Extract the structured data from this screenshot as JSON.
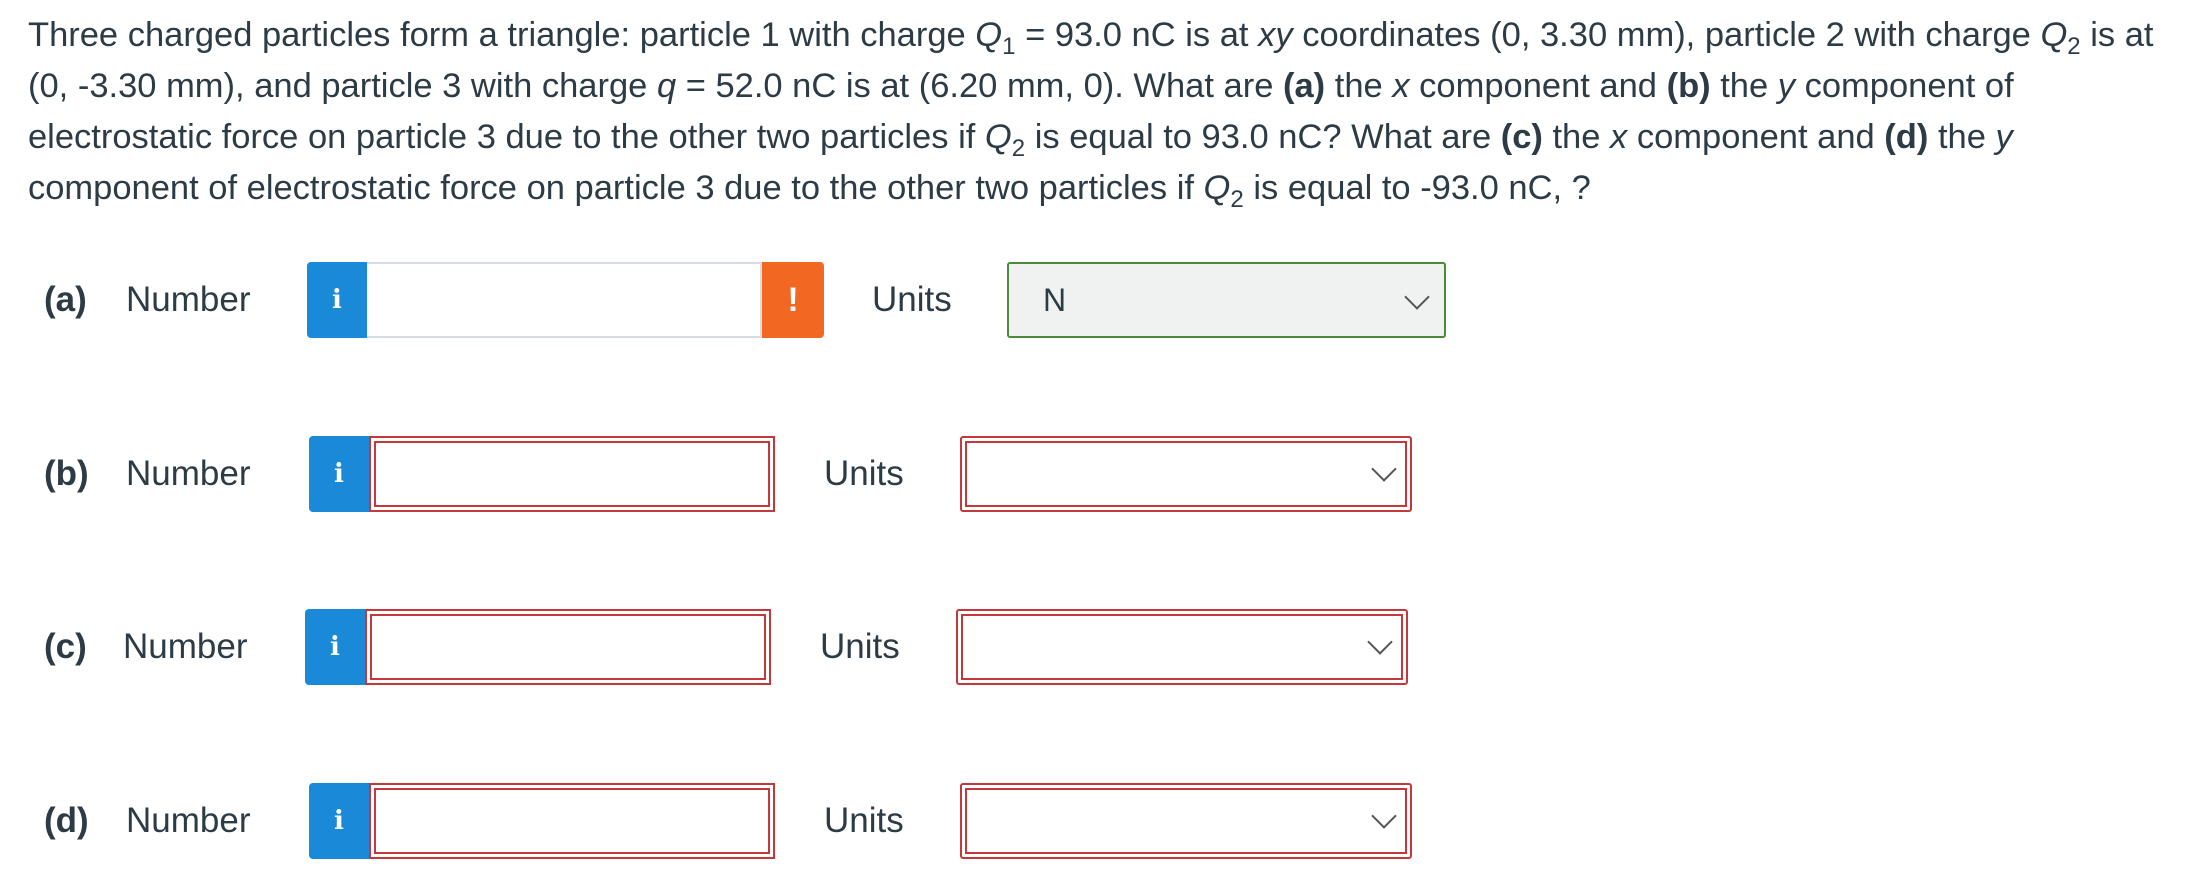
{
  "question": {
    "text_1": "Three charged particles form a triangle: particle 1 with charge ",
    "q1_symbol": "Q",
    "q1_sub": "1",
    "text_2": " = 93.0 nC is at ",
    "xy": "xy",
    "text_3": " coordinates (0, 3.30 mm), particle 2 with charge ",
    "q2_symbol": "Q",
    "q2_sub": "2",
    "text_4": " is at (0, -3.30 mm), and particle 3 with charge ",
    "q_symbol": "q",
    "text_5": " = 52.0 nC is at (6.20 mm, 0). What are ",
    "part_a": "(a)",
    "text_6": " the ",
    "x1": "x",
    "text_7": " component and ",
    "part_b": "(b)",
    "text_8": " the ",
    "y1": "y",
    "text_9": " component of electrostatic force on particle 3 due to the other two particles if ",
    "q2b_symbol": "Q",
    "q2b_sub": "2",
    "text_10": " is equal to 93.0 nC? What are ",
    "part_c": "(c)",
    "text_11": " the ",
    "x2": "x",
    "text_12": " component and ",
    "part_d": "(d)",
    "text_13": " the ",
    "y2": "y",
    "text_14": " component of electrostatic force on particle 3 due to the other two particles if ",
    "q2c_symbol": "Q",
    "q2c_sub": "2",
    "text_15": " is equal to -93.0 nC, ?"
  },
  "answers": [
    {
      "part": "(a)",
      "number_label": "Number",
      "info": "i",
      "value": "",
      "warn": "!",
      "units_label": "Units",
      "units_value": "N"
    },
    {
      "part": "(b)",
      "number_label": "Number",
      "info": "i",
      "value": "",
      "units_label": "Units",
      "units_value": ""
    },
    {
      "part": "(c)",
      "number_label": "Number",
      "info": "i",
      "value": "",
      "units_label": "Units",
      "units_value": ""
    },
    {
      "part": "(d)",
      "number_label": "Number",
      "info": "i",
      "value": "",
      "units_label": "Units",
      "units_value": ""
    }
  ],
  "colors": {
    "info_button": "#1a8ad8",
    "warning_button": "#f26722",
    "invalid_border": "#c2383b",
    "valid_border": "#4a8a3a"
  },
  "icons": {
    "info": "info-icon",
    "warning": "exclamation-icon",
    "dropdown": "chevron-down-icon"
  }
}
